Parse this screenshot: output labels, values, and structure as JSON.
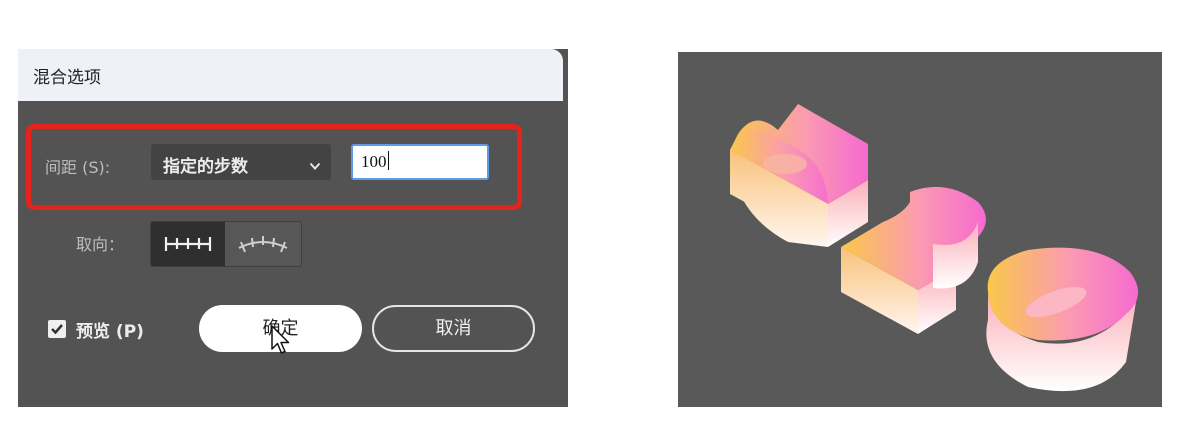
{
  "dialog": {
    "title": "混合选项",
    "spacing": {
      "label": "间距 (S):",
      "selected_option": "指定的步数",
      "steps_value": "100"
    },
    "orientation": {
      "label": "取向："
    },
    "preview": {
      "checked": true,
      "label": "预览 (P)"
    },
    "ok_label": "确定",
    "cancel_label": "取消"
  },
  "artwork": {
    "text": "520",
    "gradient_colors": [
      "#f9c84a",
      "#fb9ab2",
      "#f56ad0",
      "#ffffff"
    ]
  },
  "colors": {
    "highlight_border": "#e5221c",
    "dialog_bg": "#535353",
    "canvas_bg": "#595959"
  },
  "icons": {
    "orientation_align_page": "align-to-page-icon",
    "orientation_align_path": "align-to-path-icon",
    "cursor": "arrow-cursor-icon"
  }
}
